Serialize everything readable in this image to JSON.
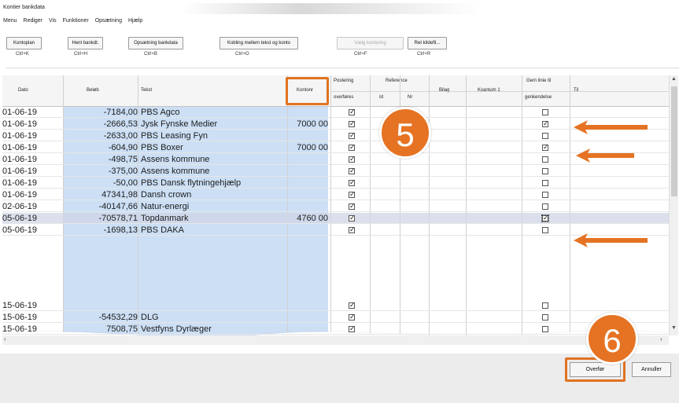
{
  "window": {
    "title": "Kontier bankdata"
  },
  "menu": [
    "Menu",
    "Rediger",
    "Vis",
    "Funktioner",
    "Opsætning",
    "Hjælp"
  ],
  "toolbar": {
    "buttons": [
      {
        "label": "Kontoplan",
        "shortcut": "Ctrl+K",
        "enabled": true
      },
      {
        "label": "Hent bankdt.",
        "shortcut": "Ctrl+H",
        "enabled": true
      },
      {
        "label": "Opsætning bankdata",
        "shortcut": "Ctrl+B",
        "enabled": true
      },
      {
        "label": "Kobling mellem tekst og konto",
        "shortcut": "Ctrl+O",
        "enabled": true
      },
      {
        "label": "Vælg kontering",
        "shortcut": "Ctrl+F",
        "enabled": false
      },
      {
        "label": "Ret kildefil...",
        "shortcut": "Ctrl+R",
        "enabled": true
      }
    ]
  },
  "table": {
    "headers": {
      "dato": "Dato",
      "belob": "Beløb",
      "tekst": "Tekst",
      "konto": "Kontonr",
      "postering_top": "Postering",
      "postering_bottom": "overføres",
      "reference": "Reference",
      "ref_id": "Id",
      "ref_nr": "Nr",
      "bilag": "Bilag",
      "kvantum": "Kvantum 1",
      "gem_top": "Gem linie til",
      "gem_bottom": "genkendelse",
      "til": "Til"
    },
    "rows": [
      {
        "date": "01-06-19",
        "amount": "-7184,00",
        "text": "PBS Agco",
        "account": "",
        "post": true,
        "save": false,
        "selected": false
      },
      {
        "date": "01-06-19",
        "amount": "-2666,53",
        "text": "Jysk Fynske Medier",
        "account": "7000 00",
        "post": true,
        "save": true,
        "selected": false
      },
      {
        "date": "01-06-19",
        "amount": "-2633,00",
        "text": "PBS Leasing Fyn",
        "account": "",
        "post": true,
        "save": false,
        "selected": false
      },
      {
        "date": "01-06-19",
        "amount": "-604,90",
        "text": "PBS Boxer",
        "account": "7000 00",
        "post": true,
        "save": true,
        "selected": false
      },
      {
        "date": "01-06-19",
        "amount": "-498,75",
        "text": "Assens kommune",
        "account": "",
        "post": true,
        "save": false,
        "selected": false
      },
      {
        "date": "01-06-19",
        "amount": "-375,00",
        "text": "Assens kommune",
        "account": "",
        "post": true,
        "save": false,
        "selected": false
      },
      {
        "date": "01-06-19",
        "amount": "-50,00",
        "text": "PBS Dansk flytningehjælp",
        "account": "",
        "post": true,
        "save": false,
        "selected": false
      },
      {
        "date": "01-06-19",
        "amount": "47341,98",
        "text": "Dansh crown",
        "account": "",
        "post": true,
        "save": false,
        "selected": false
      },
      {
        "date": "02-06-19",
        "amount": "-40147,66",
        "text": "Natur-energi",
        "account": "",
        "post": true,
        "save": false,
        "selected": false
      },
      {
        "date": "05-06-19",
        "amount": "-70578,71",
        "text": "Topdanmark",
        "account": "4760 00",
        "post": true,
        "save": true,
        "selected": true
      },
      {
        "date": "05-06-19",
        "amount": "-1698,13",
        "text": "PBS DAKA",
        "account": "",
        "post": true,
        "save": false,
        "selected": false
      }
    ],
    "bottom_rows": [
      {
        "date": "15-06-19",
        "amount": "",
        "text": "",
        "account": "",
        "post": true,
        "save": false
      },
      {
        "date": "15-06-19",
        "amount": "-54532,29",
        "text": "DLG",
        "account": "",
        "post": true,
        "save": false
      },
      {
        "date": "15-06-19",
        "amount": "7508,75",
        "text": "Vestfyns Dyrlæger",
        "account": "",
        "post": true,
        "save": false
      }
    ]
  },
  "footer": {
    "ok_label": "Overfør",
    "cancel_label": "Annuller"
  },
  "annotations": {
    "step5": "5",
    "step6": "6",
    "accent": "#e57323"
  },
  "colors": {
    "highlight_column": "#ccdff5",
    "selected_row": "#d0d6e6"
  }
}
